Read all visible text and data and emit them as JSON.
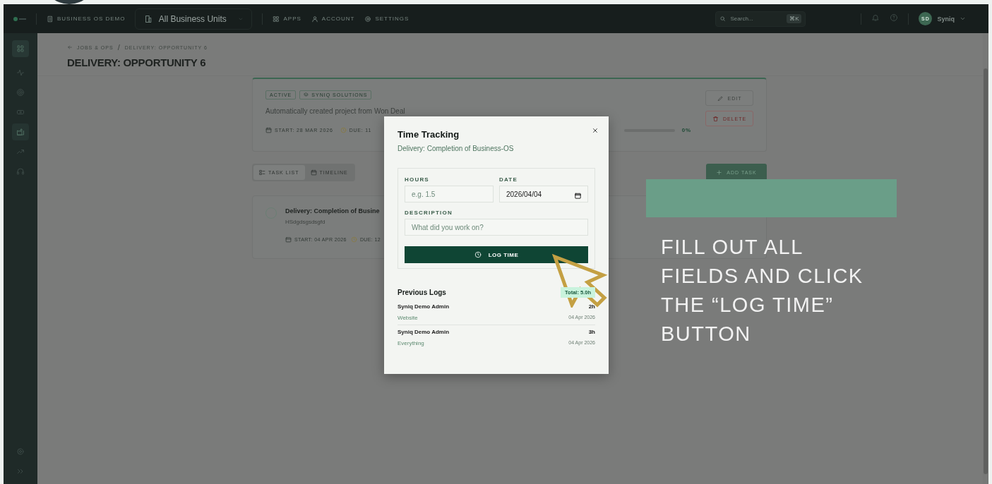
{
  "topbar": {
    "workspace": "BUSINESS OS DEMO",
    "unit_selector": "All Business Units",
    "nav": [
      "APPS",
      "ACCOUNT",
      "SETTINGS"
    ],
    "search": {
      "placeholder": "Search...",
      "shortcut": "⌘K"
    },
    "user": {
      "initials": "SD",
      "name": "Syniq"
    }
  },
  "sidebar": {
    "items": [
      {
        "selected": false
      },
      {
        "selected": false
      },
      {
        "selected": false
      },
      {
        "selected": true
      },
      {
        "selected": false
      },
      {
        "selected": false
      }
    ]
  },
  "breadcrumb": {
    "back": "JOBS & OPS",
    "separator": "/",
    "current": "DELIVERY: OPPORTUNITY 6"
  },
  "title": "DELIVERY: OPPORTUNITY 6",
  "project": {
    "tags": [
      "ACTIVE",
      "SYNIQ SOLUTIONS"
    ],
    "description": "Automatically created project from Won Deal",
    "start": "START: 28 MAR 2026",
    "due": "DUE: 11",
    "progress": {
      "level": 0,
      "reading": "0%"
    },
    "buttons": [
      {
        "kind": "edit",
        "label": "EDIT"
      },
      {
        "kind": "delete",
        "label": "DELETE"
      }
    ]
  },
  "views": [
    {
      "label": "TASK LIST",
      "selected": true
    },
    {
      "label": "TIMELINE",
      "selected": false
    }
  ],
  "add_task": "ADD TASK",
  "tasks": [
    {
      "title": "Delivery: Completion of Busine",
      "subtitle": "HSdgdsgsdsgfd",
      "start": "START: 04 APR 2026",
      "due": "DUE: 12",
      "done": false
    }
  ],
  "modal": {
    "title": "Time Tracking",
    "subtitle": "Delivery: Completion of Business-OS",
    "hours": {
      "label": "HOURS",
      "placeholder": "e.g. 1.5"
    },
    "date": {
      "label": "DATE",
      "value": "2026/04/04"
    },
    "description": {
      "label": "DESCRIPTION",
      "placeholder": "What did you work on?"
    },
    "submit": "LOG TIME",
    "logs_title": "Previous Logs",
    "total": "Total: 5.0h",
    "logs": [
      {
        "user": "Syniq Demo Admin",
        "hours": "2h",
        "note": "Website",
        "date": "04 Apr 2026"
      },
      {
        "user": "Syniq Demo Admin",
        "hours": "3h",
        "note": "Everything",
        "date": "04 Apr 2026"
      }
    ]
  },
  "annotation": {
    "text": "FILL OUT ALL FIELDS AND CLICK THE “LOG TIME” BUTTON"
  }
}
